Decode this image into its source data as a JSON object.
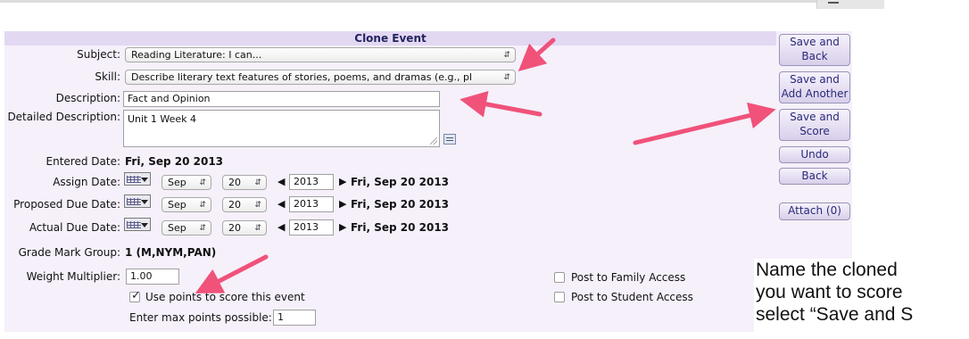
{
  "dialog": {
    "title": "Clone Event"
  },
  "form": {
    "subject": {
      "label": "Subject:",
      "value": "Reading Literature: I can..."
    },
    "skill": {
      "label": "Skill:",
      "value": "Describe literary text features of stories, poems, and dramas (e.g., pl"
    },
    "description": {
      "label": "Description:",
      "value": "Fact and Opinion"
    },
    "detailed_description": {
      "label": "Detailed Description:",
      "value": "Unit 1 Week 4"
    },
    "entered_date": {
      "label": "Entered Date:",
      "value": "Fri, Sep 20 2013"
    },
    "assign_date": {
      "label": "Assign Date:",
      "month": "Sep",
      "day": "20",
      "year": "2013",
      "display": "Fri, Sep 20 2013"
    },
    "proposed_due_date": {
      "label": "Proposed Due Date:",
      "month": "Sep",
      "day": "20",
      "year": "2013",
      "display": "Fri, Sep 20 2013"
    },
    "actual_due_date": {
      "label": "Actual Due Date:",
      "month": "Sep",
      "day": "20",
      "year": "2013",
      "display": "Fri, Sep 20 2013"
    },
    "grade_mark_group": {
      "label": "Grade Mark Group:",
      "value": "1 (M,NYM,PAN)"
    },
    "weight_multiplier": {
      "label": "Weight Multiplier:",
      "value": "1.00"
    },
    "use_points": {
      "label": "Use points to score this event",
      "checked": true
    },
    "max_points": {
      "label": "Enter max points possible:",
      "value": "1"
    },
    "post_family": {
      "label": "Post to Family Access",
      "checked": false
    },
    "post_student": {
      "label": "Post to Student Access",
      "checked": false
    }
  },
  "sidebar": {
    "save_back": [
      "Save and",
      "Back"
    ],
    "save_add": [
      "Save and",
      "Add Another"
    ],
    "save_score": [
      "Save and",
      "Score"
    ],
    "undo": "Undo",
    "back": "Back",
    "attach": "Attach (0)"
  },
  "annotation": {
    "line1": "Name the cloned",
    "line2": "you want to score",
    "line3": "select “Save and S"
  },
  "colors": {
    "panel_bg": "#f5f0fa",
    "title_text": "#23235f",
    "arrow": "#f0527a"
  },
  "icons": [
    "calendar-icon",
    "chevron-updown-icon",
    "arrow-left-icon",
    "arrow-right-icon",
    "notes-icon"
  ]
}
